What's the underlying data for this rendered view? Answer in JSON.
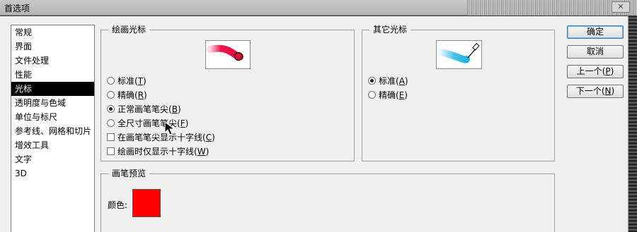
{
  "window": {
    "title": "首选项",
    "close_glyph": "✕"
  },
  "nav": {
    "items": [
      {
        "label": "常规",
        "selected": false
      },
      {
        "label": "界面",
        "selected": false
      },
      {
        "label": "文件处理",
        "selected": false
      },
      {
        "label": "性能",
        "selected": false
      },
      {
        "label": "光标",
        "selected": true
      },
      {
        "label": "透明度与色域",
        "selected": false
      },
      {
        "label": "单位与标尺",
        "selected": false
      },
      {
        "label": "参考线、网格和切片",
        "selected": false
      },
      {
        "label": "增效工具",
        "selected": false
      },
      {
        "label": "文字",
        "selected": false
      },
      {
        "label": "3D",
        "selected": false
      }
    ]
  },
  "painting_cursors": {
    "legend": "绘画光标",
    "options": [
      {
        "label": "标准",
        "key": "T",
        "selected": false
      },
      {
        "label": "精确",
        "key": "R",
        "selected": false
      },
      {
        "label": "正常画笔笔尖",
        "key": "B",
        "selected": true
      },
      {
        "label": "全尺寸画笔笔尖",
        "key": "F",
        "selected": false
      }
    ],
    "checkboxes": [
      {
        "label": "在画笔笔尖显示十字线",
        "key": "C",
        "checked": false
      },
      {
        "label": "绘画时仅显示十字线",
        "key": "W",
        "checked": false
      }
    ]
  },
  "other_cursors": {
    "legend": "其它光标",
    "options": [
      {
        "label": "标准",
        "key": "A",
        "selected": true
      },
      {
        "label": "精确",
        "key": "E",
        "selected": false
      }
    ]
  },
  "brush_preview": {
    "legend": "画笔预览",
    "color_label": "颜色:",
    "color": "#ff0000"
  },
  "buttons": {
    "ok": {
      "label": "确定"
    },
    "cancel": {
      "label": "取消"
    },
    "prev": {
      "label": "上一个",
      "key": "P"
    },
    "next": {
      "label": "下一个",
      "key": "N"
    }
  },
  "colors": {
    "selection": "#000000",
    "brush_stroke": "#e8003a",
    "eyedropper_stroke": "#22b3e6"
  }
}
